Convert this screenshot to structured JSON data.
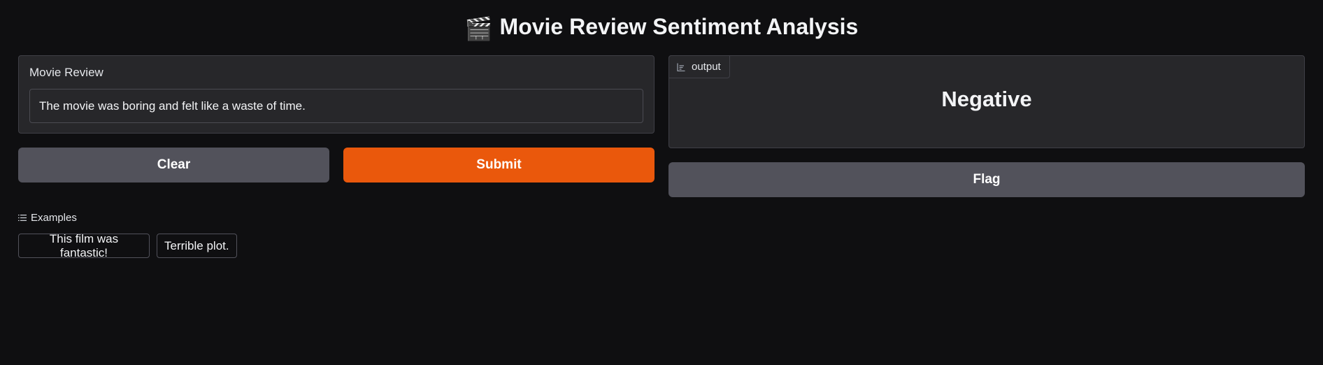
{
  "app": {
    "title": "Movie Review Sentiment Analysis",
    "title_emoji": "🎬"
  },
  "input": {
    "label": "Movie Review",
    "value": "The movie was boring and felt like a waste of time.",
    "placeholder": ""
  },
  "buttons": {
    "clear_label": "Clear",
    "submit_label": "Submit",
    "flag_label": "Flag"
  },
  "output": {
    "tab_label": "output",
    "tab_icon": "bar-chart-icon",
    "value": "Negative"
  },
  "examples": {
    "header": "Examples",
    "header_icon": "list-icon",
    "items": [
      "This film was fantastic!",
      "Terrible plot."
    ]
  },
  "colors": {
    "background": "#0f0f11",
    "panel": "#27272a",
    "primary_button": "#ea580c",
    "secondary_button": "#52525b"
  }
}
